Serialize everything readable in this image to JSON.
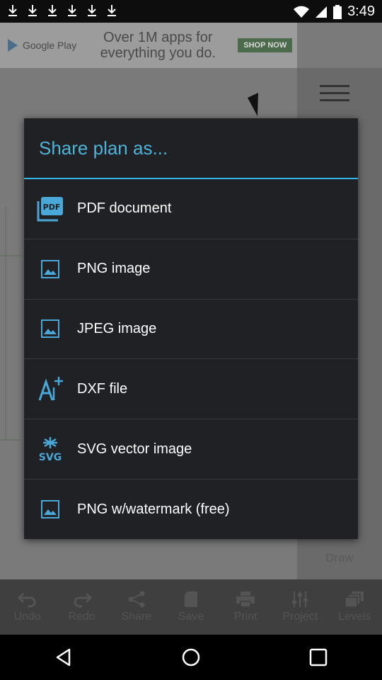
{
  "status_bar": {
    "time": "3:49",
    "left_icons": [
      "download-icon",
      "download-icon",
      "download-icon",
      "download-icon",
      "download-icon",
      "download-icon"
    ],
    "right_icons": [
      "wifi-icon",
      "signal-icon",
      "battery-icon"
    ]
  },
  "ad": {
    "store_name": "Google Play",
    "text": "Over 1M apps for everything you do.",
    "cta": "SHOP NOW"
  },
  "right_panel": {
    "draw_label": "Draw"
  },
  "toolbar": {
    "items": [
      {
        "label": "Undo",
        "icon": "undo-icon"
      },
      {
        "label": "Redo",
        "icon": "redo-icon"
      },
      {
        "label": "Share",
        "icon": "share-icon"
      },
      {
        "label": "Save",
        "icon": "sd-card-icon"
      },
      {
        "label": "Print",
        "icon": "printer-icon"
      },
      {
        "label": "Project",
        "icon": "sliders-icon"
      },
      {
        "label": "Levels",
        "icon": "layers-icon"
      }
    ]
  },
  "dialog": {
    "title": "Share plan as...",
    "accent_color": "#33b5e5",
    "options": [
      {
        "label": "PDF document",
        "icon": "pdf-icon"
      },
      {
        "label": "PNG image",
        "icon": "image-icon"
      },
      {
        "label": "JPEG image",
        "icon": "image-icon"
      },
      {
        "label": "DXF file",
        "icon": "dxf-icon"
      },
      {
        "label": "SVG vector image",
        "icon": "svg-icon"
      },
      {
        "label": "PNG w/watermark (free)",
        "icon": "image-icon"
      }
    ]
  },
  "nav_bar": {
    "buttons": [
      "back-icon",
      "home-icon",
      "recents-icon"
    ]
  }
}
